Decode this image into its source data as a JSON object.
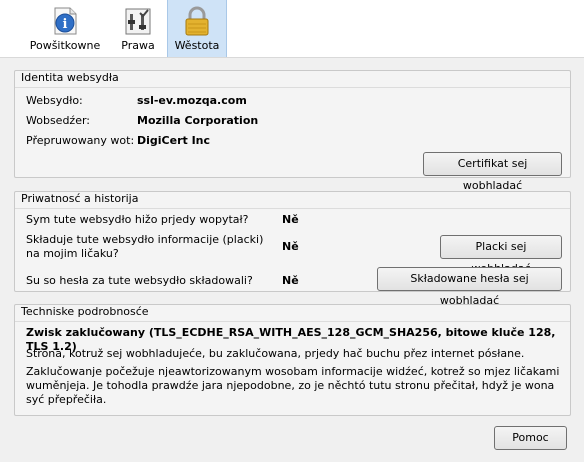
{
  "tabs": [
    {
      "label": "Powšitkowne",
      "icon": "info-icon"
    },
    {
      "label": "Prawa",
      "icon": "permissions-icon"
    },
    {
      "label": "Wěstota",
      "icon": "padlock-icon"
    }
  ],
  "identity": {
    "title": "Identita websydła",
    "website_label": "Websydło:",
    "website_value": "ssl-ev.mozqa.com",
    "owner_label": "Wobsedźer:",
    "owner_value": "Mozilla Corporation",
    "verified_label": "Přepruwowany wot:",
    "verified_value": "DigiCert Inc",
    "cert_button": "Certifikat sej wobhladać"
  },
  "privacy": {
    "title": "Priwatnosć a historija",
    "q1": "Sym tute websydło hižo prjedy wopytał?",
    "a1": "Ně",
    "q2_line1": "Składuje tute websydło informacije (placki)",
    "q2_line2": "na mojim ličaku?",
    "a2": "Ně",
    "cookies_button": "Placki sej wobhladać",
    "q3": "Su so hesła za tute websydło składowali?",
    "a3": "Ně",
    "passwords_button": "Składowane hesła sej wobhladać"
  },
  "tech": {
    "title": "Techniske podrobnosće",
    "headline": "Zwisk zaklučowany (TLS_ECDHE_RSA_WITH_AES_128_GCM_SHA256, bitowe kluče 128, TLS 1.2)",
    "para1": "Strona, kotruž sej wobhladujeće, bu zaklučowana, prjedy hač buchu přez internet pósłane.",
    "para2": "Zaklučowanje počežuje njeawtorizowanym wosobam informacije widźeć, kotrež so mjez ličakami wuměnjeja. Je tohodla prawdźe jara njepodobne, zo je něchtó tutu stronu přečitał, hdyž je wona syć přepřečiła."
  },
  "help_button": "Pomoc",
  "colors": {
    "selected_tab": "#cfe3f7",
    "lock": "#d9a21b"
  }
}
